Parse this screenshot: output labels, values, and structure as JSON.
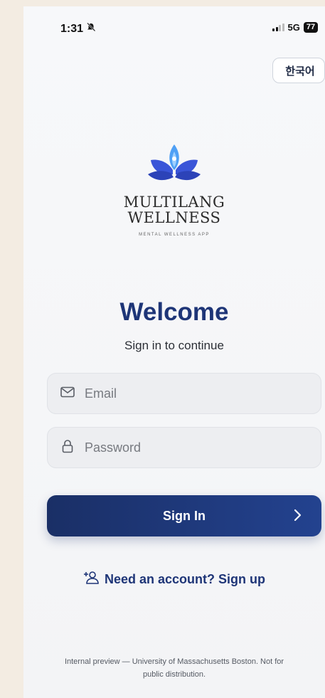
{
  "status": {
    "time": "1:31",
    "network": "5G",
    "battery": "77"
  },
  "language_button": "한국어",
  "brand": {
    "line1": "MULTILANG",
    "line2": "WELLNESS",
    "tagline": "MENTAL WELLNESS APP",
    "colors": {
      "petal_dark": "#3a55d8",
      "petal_light": "#4fa0f5"
    }
  },
  "welcome": {
    "title": "Welcome",
    "subtitle": "Sign in to continue"
  },
  "form": {
    "email_placeholder": "Email",
    "password_placeholder": "Password",
    "signin_label": "Sign In"
  },
  "signup_link": "Need an account? Sign up",
  "footer": {
    "line1": "Internal preview — University of Massachusetts Boston. Not for",
    "line2": "public distribution."
  },
  "theme": {
    "primary": "#1e3577",
    "button_start": "#1a2f66",
    "button_end": "#23428f"
  }
}
